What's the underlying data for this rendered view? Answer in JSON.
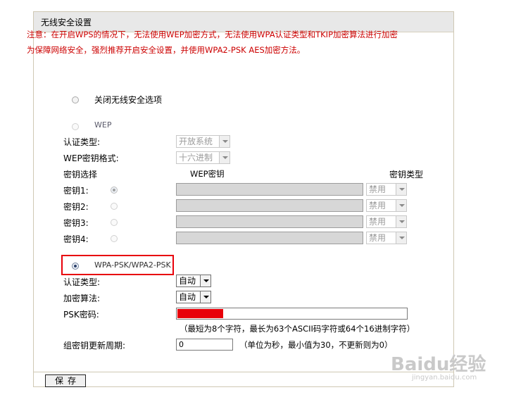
{
  "panel": {
    "title": "无线安全设置",
    "notice": "注意：在开启WPS的情况下，无法使用WEP加密方式，无法使用WPA认证类型和TKIP加密算法进行加密为保障网络安全，强烈推荐开启安全设置，并使用WPA2-PSK AES加密方法。"
  },
  "options": {
    "disable_label": "关闭无线安全选项",
    "wep_label": "WEP",
    "wpa_label": "WPA-PSK/WPA2-PSK"
  },
  "wep": {
    "auth_type_label": "认证类型:",
    "auth_type_value": "开放系统",
    "key_format_label": "WEP密钥格式:",
    "key_format_value": "十六进制",
    "key_select_label": "密钥选择",
    "wep_key_header": "WEP密钥",
    "key_type_header": "密钥类型",
    "keys": [
      {
        "label": "密钥1:",
        "type": "禁用"
      },
      {
        "label": "密钥2:",
        "type": "禁用"
      },
      {
        "label": "密钥3:",
        "type": "禁用"
      },
      {
        "label": "密钥4:",
        "type": "禁用"
      }
    ]
  },
  "wpa": {
    "auth_type_label": "认证类型:",
    "auth_type_value": "自动",
    "cipher_label": "加密算法:",
    "cipher_value": "自动",
    "psk_label": "PSK密码:",
    "psk_masked_fraction": 0.2,
    "psk_hint": "（最短为8个字符，最长为63个ASCII码字符或64个16进制字符）",
    "rekey_label": "组密钥更新周期:",
    "rekey_value": "0",
    "rekey_hint": "（单位为秒，最小值为30，不更新则为0）"
  },
  "footer": {
    "save_label": "保存"
  },
  "watermark": {
    "text": "Baidu经验",
    "sub": "jingyan.baidu.com"
  },
  "colors": {
    "notice": "#cc0000",
    "highlight": "#e8000a",
    "psk_fill": "#e8000a"
  }
}
